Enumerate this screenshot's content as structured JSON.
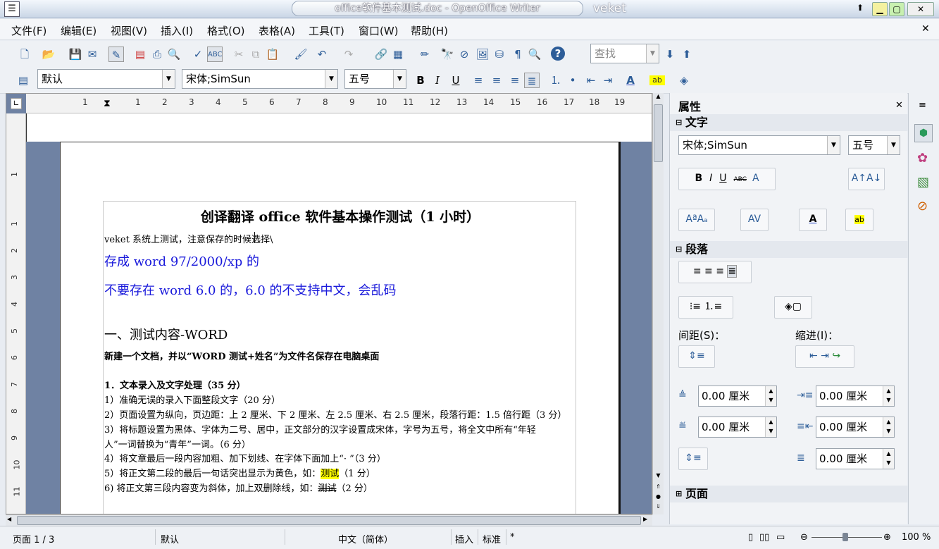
{
  "titlebar": {
    "title": "office软件基本测试.doc - OpenOffice Writer",
    "user": "veket"
  },
  "menu": [
    "文件(F)",
    "编辑(E)",
    "视图(V)",
    "插入(I)",
    "格式(O)",
    "表格(A)",
    "工具(T)",
    "窗口(W)",
    "帮助(H)"
  ],
  "toolbar": {
    "search_placeholder": "查找"
  },
  "formatting": {
    "style": "默认",
    "font": "宋体;SimSun",
    "size": "五号"
  },
  "ruler": {
    "h_ticks": [
      "1",
      "1",
      "2",
      "3",
      "4",
      "5",
      "6",
      "7",
      "8",
      "9",
      "10",
      "11",
      "12",
      "13",
      "14",
      "15",
      "16",
      "17",
      "18",
      "19"
    ],
    "v_ticks": [
      "1",
      "1",
      "2",
      "3",
      "4",
      "5",
      "6",
      "7",
      "8",
      "9",
      "10",
      "11"
    ]
  },
  "document": {
    "title": "创译翻译 office 软件基本操作测试（1 小时）",
    "line1": "veket 系统上测试，注意保存的时候选择\\",
    "line2": "存成 word 97/2000/xp 的",
    "line3": "不要存在 word 6.0 的，6.0 的不支持中文，会乱码",
    "heading": "一、测试内容-WORD",
    "instruction": "新建一个文档，并以“WORD 测试+姓名”为文件名保存在电脑桌面",
    "section1": "1．文本录入及文字处理（35 分）",
    "items": [
      "1）准确无误的录入下面整段文字（20 分）",
      "2）页面设置为纵向，页边距：上 2 厘米、下 2 厘米、左 2.5 厘米、右 2.5 厘米，段落行距：1.5 倍行距（3 分）",
      "3）将标题设置为黑体、字体为二号、居中，正文部分的汉字设置成宋体，字号为五号，将全文中所有“年轻",
      "人”一词替换为“青年”一词。（6 分）",
      "4）将文章最后一段内容加粗、加下划线、在字体下面加上“· ”（3 分）"
    ],
    "item5_pre": "5）将正文第二段的最后一句话突出显示为黄色，如：",
    "item5_hl": "测试",
    "item5_post": "（1 分）",
    "item6_pre": "6) 将正文第三段内容变为斜体，加上双删除线，如：",
    "item6_strike": "测试",
    "item6_post": "（2 分）"
  },
  "sidebar": {
    "title": "属性",
    "text_section": "文字",
    "font": "宋体;SimSun",
    "size": "五号",
    "para_section": "段落",
    "spacing_label": "间距(S)：",
    "indent_label": "缩进(I)：",
    "above": "0.00 厘米",
    "below": "0.00 厘米",
    "indent_before": "0.00 厘米",
    "indent_after": "0.00 厘米",
    "first_line": "0.00 厘米",
    "page_section": "页面"
  },
  "status": {
    "page": "页面 1 / 3",
    "style": "默认",
    "lang": "中文（简体）",
    "mode": "插入",
    "sel": "标准",
    "mod": "*",
    "zoom": "100 %"
  },
  "colors": {
    "blue_text": "#1a1adb",
    "highlight": "#ffff00",
    "accent": "#2d5d98"
  }
}
